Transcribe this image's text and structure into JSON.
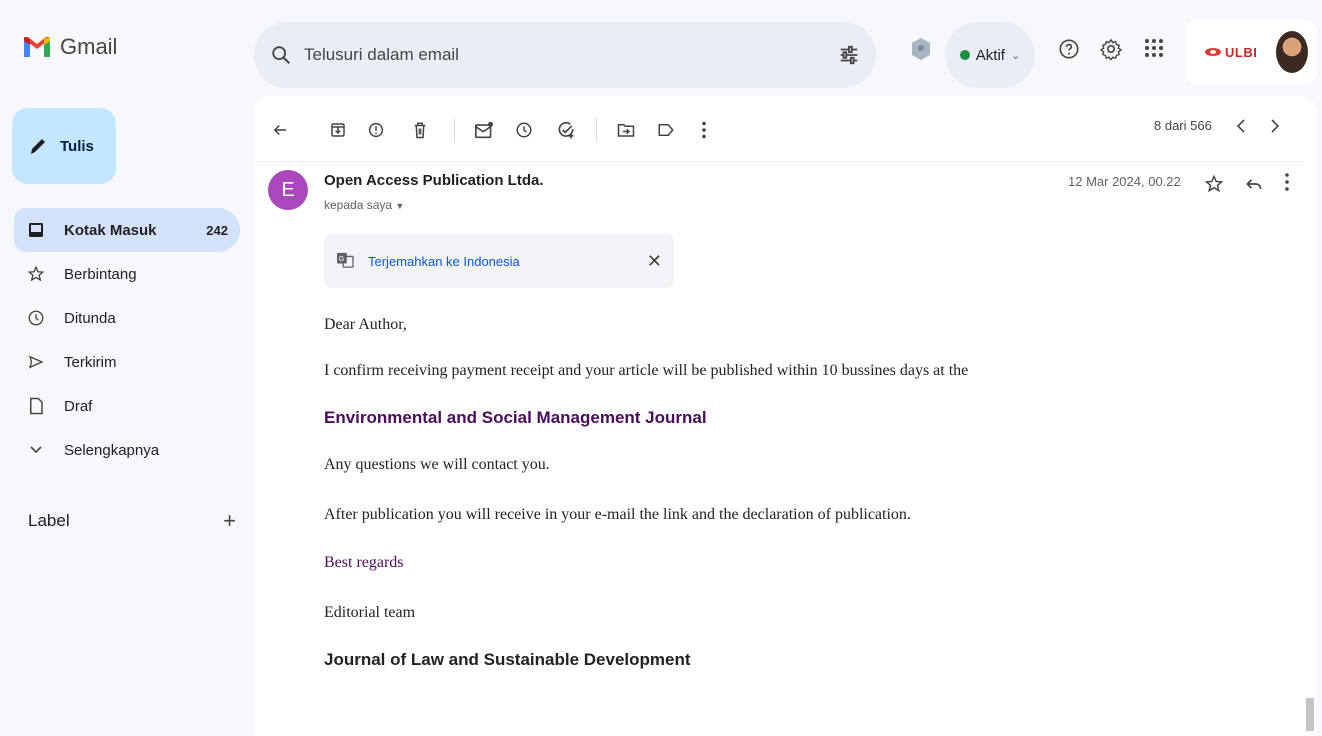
{
  "app": {
    "name": "Gmail"
  },
  "search": {
    "placeholder": "Telusuri dalam email"
  },
  "status": {
    "label": "Aktif"
  },
  "account": {
    "org": "ULBI"
  },
  "compose": {
    "label": "Tulis"
  },
  "nav": [
    {
      "label": "Kotak Masuk",
      "count": "242",
      "icon": "inbox-icon"
    },
    {
      "label": "Berbintang",
      "icon": "star-icon"
    },
    {
      "label": "Ditunda",
      "icon": "clock-icon"
    },
    {
      "label": "Terkirim",
      "icon": "send-icon"
    },
    {
      "label": "Draf",
      "icon": "draft-icon"
    },
    {
      "label": "Selengkapnya",
      "icon": "chevron-down-icon"
    }
  ],
  "labels": {
    "title": "Label"
  },
  "pager": {
    "text": "8 dari 566"
  },
  "message": {
    "sender_initial": "E",
    "sender": "Open Access Publication Ltda.",
    "to": "kepada saya",
    "date": "12 Mar 2024, 00.22",
    "translate": "Terjemahkan ke Indonesia",
    "body": {
      "greeting": "Dear Author,",
      "line1": "I confirm receiving payment receipt and your article will be published within 10 bussines days at the",
      "journal": "Environmental and Social Management Journal",
      "line2": "Any questions we will contact you.",
      "line3": "After publication you will receive in your e-mail the link and the declaration of publication.",
      "regards": "Best regards",
      "team": "Editorial team",
      "journal2": "Journal of Law and Sustainable Development"
    }
  },
  "colors": {
    "accent": "#c2e7ff",
    "active_nav": "#d3e3fd",
    "avatar": "#ab47bc",
    "journal_link": "#4a0d5c"
  }
}
